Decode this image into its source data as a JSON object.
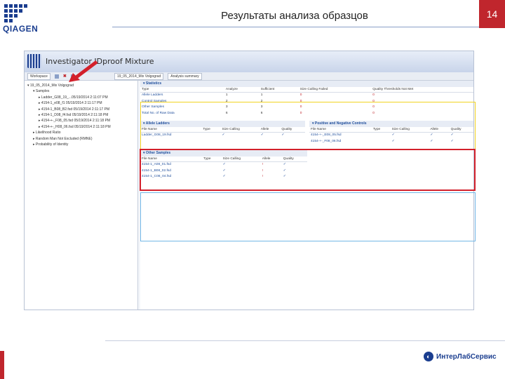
{
  "header": {
    "title": "Результаты анализа образцов",
    "page_number": "14",
    "logo_text": "QIAGEN"
  },
  "footer": {
    "brand": "ИнтерЛабСервис"
  },
  "app": {
    "title": "Investigator IDproof Mixture",
    "workspace_tab": "Workspace",
    "doc_tab": "19_05_2014_Mix Volgograd",
    "summary_tab": "Analysis summary"
  },
  "tree": [
    "19_05_2014_Mix Volgograd",
    "Samples",
    "Ladder_G08_19_...05/19/2014 2:11:07 PM",
    "4154-1_e08_f1 05/19/2014 2:11:17 PM",
    "4154-1_B08_B2.fsd 05/19/2014 2:11:17 PM",
    "4154-1_D08_f4.fsd 05/19/2014 2:11:18 PM",
    "4154-+-_F08_05.fsd 05/19/2014 2:11:18 PM",
    "4154-+-_H08_06.fsd 05/19/2014 2:11:18 PM",
    "Likelihood Ratio",
    "Random Man Not Excluded (RMNE)",
    "Probability of Identity"
  ],
  "statistics": {
    "header": "Statistics",
    "columns": [
      "Type",
      "Analyze",
      "Sufficient",
      "Size Calling Failed",
      "Quality Thresholds Not Met"
    ],
    "rows": [
      [
        "Allele Ladders",
        "1",
        "1",
        "0",
        "0"
      ],
      [
        "Control Samples",
        "2",
        "2",
        "0",
        "0"
      ],
      [
        "Other Samples",
        "3",
        "3",
        "0",
        "0"
      ],
      [
        "Total No. of Raw Data",
        "6",
        "6",
        "0",
        "0"
      ]
    ]
  },
  "allele_ladders": {
    "header": "Allele Ladders",
    "columns": [
      "File Name",
      "Type",
      "Size Calling",
      "Allele",
      "Quality"
    ],
    "rows": [
      [
        "Ladder_G08_19.fsd",
        "",
        "✓",
        "✓",
        "✓"
      ]
    ]
  },
  "controls": {
    "header": "Positive and Negative Controls",
    "columns": [
      "File Name",
      "Type",
      "Size Calling",
      "Allele",
      "Quality"
    ],
    "rows": [
      [
        "4154-+-_E08_05.fsd",
        "",
        "✓",
        "✓",
        "✓"
      ],
      [
        "4154-+-_F08_06.fsd",
        "",
        "✓",
        "✓",
        "✓"
      ]
    ]
  },
  "other_samples": {
    "header": "Other Samples",
    "columns": [
      "File Name",
      "Type",
      "Size Calling",
      "Allele",
      "Quality"
    ],
    "rows": [
      [
        "4154-1_A08_01.fsd",
        "",
        "✓",
        "!",
        "✓"
      ],
      [
        "4154-1_B08_02.fsd",
        "",
        "✓",
        "!",
        "✓"
      ],
      [
        "4154-1_C08_04.fsd",
        "",
        "✓",
        "!",
        "✓"
      ]
    ]
  }
}
